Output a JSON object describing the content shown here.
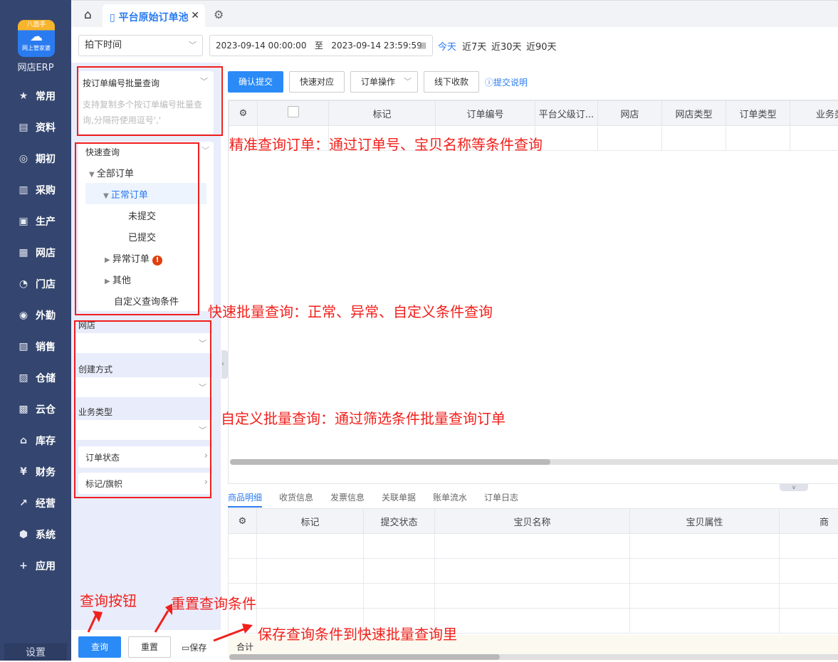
{
  "sidebar": {
    "logo_top": "八面手",
    "logo_sub": "网上管家婆",
    "brand": "网店ERP",
    "items": [
      {
        "label": "常用",
        "icon": "★"
      },
      {
        "label": "资料",
        "icon": "▤"
      },
      {
        "label": "期初",
        "icon": "◎"
      },
      {
        "label": "采购",
        "icon": "▥"
      },
      {
        "label": "生产",
        "icon": "▣"
      },
      {
        "label": "网店",
        "icon": "▦"
      },
      {
        "label": "门店",
        "icon": "◔"
      },
      {
        "label": "外勤",
        "icon": "◉"
      },
      {
        "label": "销售",
        "icon": "▧"
      },
      {
        "label": "仓储",
        "icon": "▨"
      },
      {
        "label": "云仓",
        "icon": "▩"
      },
      {
        "label": "库存",
        "icon": "⌂"
      },
      {
        "label": "财务",
        "icon": "¥"
      },
      {
        "label": "经营",
        "icon": "↗"
      },
      {
        "label": "系统",
        "icon": "⬢"
      },
      {
        "label": "应用",
        "icon": "+"
      }
    ],
    "settings": "设置"
  },
  "tabs": {
    "active": "平台原始订单池"
  },
  "filter": {
    "time_type": "拍下时间",
    "start": "2023-09-14 00:00:00",
    "to": "至",
    "end": "2023-09-14 23:59:59",
    "quick": [
      "今天",
      "近7天",
      "近30天",
      "近90天"
    ]
  },
  "left": {
    "batch_title": "按订单编号批量查询",
    "batch_placeholder": "支持复制多个按订单编号批量查询,分隔符使用逗号','",
    "quick_title": "快速查询",
    "tree": {
      "all": "全部订单",
      "normal": "正常订单",
      "unsubmitted": "未提交",
      "submitted": "已提交",
      "abnormal": "异常订单",
      "other": "其他",
      "custom": "自定义查询条件"
    },
    "filters": {
      "shop": "网店",
      "create": "创建方式",
      "biz": "业务类型",
      "status": "订单状态",
      "flag": "标记/旗帜"
    },
    "query": "查询",
    "reset": "重置",
    "save": "保存"
  },
  "toolbar": {
    "confirm": "确认提交",
    "match": "快速对应",
    "ops": "订单操作",
    "offline": "线下收款",
    "help": "提交说明"
  },
  "grid": {
    "headers": [
      "标记",
      "订单编号",
      "平台父级订...",
      "网店",
      "网店类型",
      "订单类型",
      "业务类"
    ]
  },
  "bottom": {
    "tabs": [
      "商品明细",
      "收货信息",
      "发票信息",
      "关联单据",
      "账单流水",
      "订单日志"
    ],
    "headers": [
      "标记",
      "提交状态",
      "宝贝名称",
      "宝贝属性",
      "商"
    ],
    "total": "合计"
  },
  "annotations": {
    "a1": "精准查询订单：通过订单号、宝贝名称等条件查询",
    "a2": "快速批量查询：正常、异常、自定义条件查询",
    "a3": "自定义批量查询：通过筛选条件批量查询订单",
    "a4": "查询按钮",
    "a5": "重置查询条件",
    "a6": "保存查询条件到快速批量查询里"
  }
}
